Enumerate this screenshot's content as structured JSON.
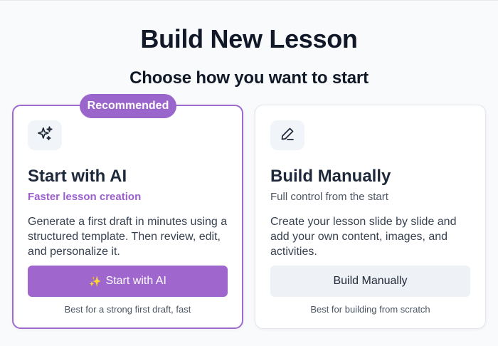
{
  "page": {
    "title": "Build New Lesson",
    "subtitle": "Choose how you want to start"
  },
  "cards": {
    "ai": {
      "badge": "Recommended",
      "icon": "sparkles-icon",
      "title": "Start with AI",
      "tagline": "Faster lesson creation",
      "description": "Generate a first draft in minutes using a structured template. Then review, edit, and personalize it.",
      "button_emoji": "✨",
      "button_label": "Start with AI",
      "footnote": "Best for a strong first draft, fast"
    },
    "manual": {
      "icon": "pencil-icon",
      "title": "Build Manually",
      "tagline": "Full control from the start",
      "description": "Create your lesson slide by slide and add your own content, images, and activities.",
      "button_label": "Build Manually",
      "footnote": "Best for building from scratch"
    }
  },
  "colors": {
    "accent": "#9b66cc",
    "page_background": "#f8fafc",
    "card_background": "#ffffff",
    "secondary_button": "#eef2f7"
  }
}
